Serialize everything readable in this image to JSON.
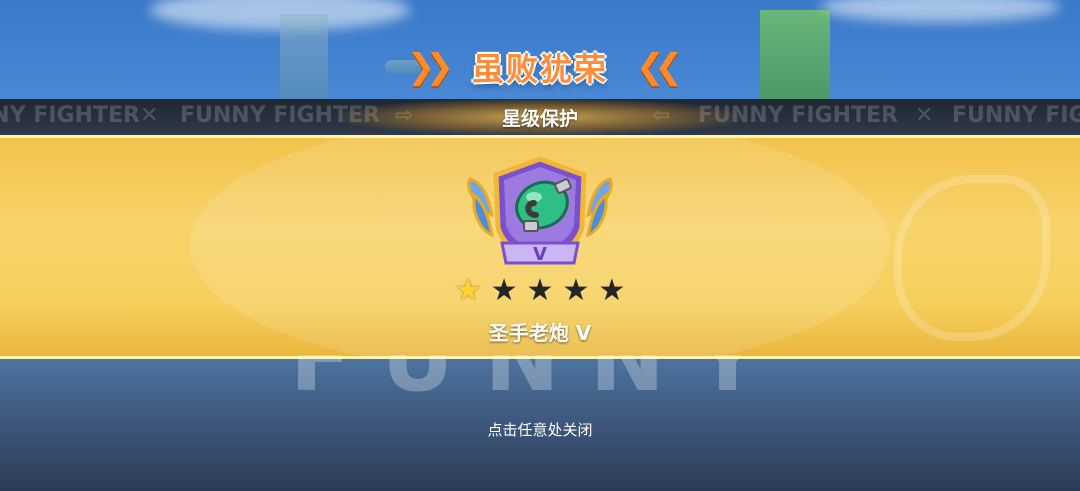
{
  "popup": {
    "title": "虽败犹荣",
    "left_chevrons": "»",
    "right_chevrons": "«",
    "subtitle": "星级保护",
    "badge": {
      "icon": "cannon-hand-rank-badge-icon",
      "roman_numeral": "V"
    },
    "stars": {
      "filled": 1,
      "total": 5
    },
    "item_name": "圣手老炮 V",
    "close_hint": "点击任意处关闭"
  },
  "background": {
    "marquee_text": [
      "FUNNY FIGHTER",
      "FUNNY FIGHTER",
      "FUNNY FIGHTER",
      "FUNNY FIGHTER"
    ],
    "floor_text": "FUNNY"
  },
  "colors": {
    "title_orange": "#ff8c3a",
    "band_gold": "#f6d05d",
    "band_dark": "#2a333f",
    "star_lit": "#ffd23a",
    "star_dim": "#242424"
  }
}
